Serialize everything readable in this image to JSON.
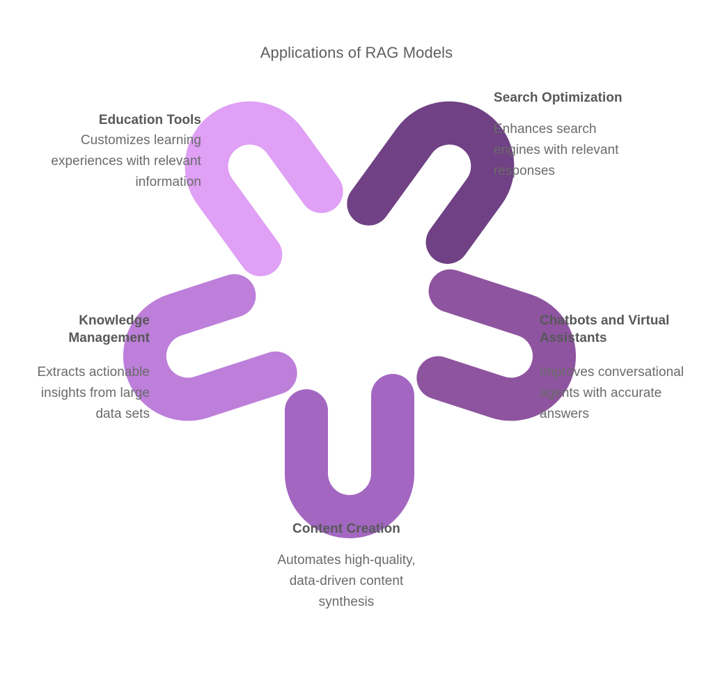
{
  "title": "Applications of RAG Models",
  "background_color": "#ffffff",
  "text_colors": {
    "title": "#5f5f5f",
    "heading": "#585858",
    "description": "#6a6a6a"
  },
  "graphic": {
    "name": "five-loop-interlocking-knot",
    "description": "Five interlocking hook-shaped loops arranged radially, each in a different shade of purple",
    "segment_count": 5,
    "colors": [
      "#dfa0f5",
      "#704184",
      "#8e549f",
      "#a367c1",
      "#bd7fda"
    ]
  },
  "nodes": [
    {
      "id": "education-tools",
      "heading": "Education Tools",
      "description": "Customizes learning experiences with relevant information",
      "color": "#dfa0f5",
      "align": "right"
    },
    {
      "id": "search-optimization",
      "heading": "Search Optimization",
      "description": "Enhances search engines with relevant responses",
      "color": "#704184",
      "align": "left"
    },
    {
      "id": "chatbots-and-virtual-assistants",
      "heading": "Chatbots and Virtual Assistants",
      "description": "Improves conversational agents with accurate answers",
      "color": "#8e549f",
      "align": "left"
    },
    {
      "id": "content-creation",
      "heading": "Content Creation",
      "description": "Automates high-quality, data-driven content synthesis",
      "color": "#a367c1",
      "align": "center"
    },
    {
      "id": "knowledge-management",
      "heading": "Knowledge Management",
      "description": "Extracts actionable insights from large data sets",
      "color": "#bd7fda",
      "align": "right"
    }
  ],
  "chart_data": {
    "type": "diagram",
    "title": "Applications of RAG Models",
    "categories": [
      "Education Tools",
      "Search Optimization",
      "Chatbots and Virtual Assistants",
      "Content Creation",
      "Knowledge Management"
    ],
    "values": [
      "Customizes learning experiences with relevant information",
      "Enhances search engines with relevant responses",
      "Improves conversational agents with accurate answers",
      "Automates high-quality, data-driven content synthesis",
      "Extracts actionable insights from large data sets"
    ],
    "legend_position": "none",
    "grid": false
  }
}
